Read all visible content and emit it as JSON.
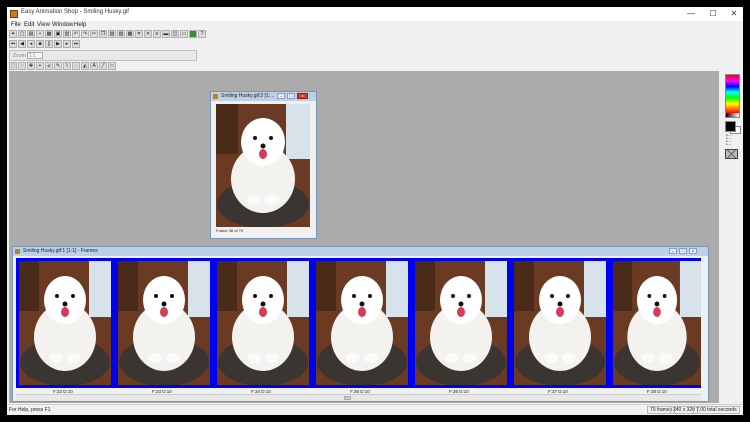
{
  "window": {
    "title": "Easy Animation Shop - Smiling Husky.gif",
    "controls": {
      "minimize": "—",
      "maximize": "☐",
      "close": "✕"
    }
  },
  "menu": [
    "File",
    "Edit",
    "View",
    "Window",
    "Help"
  ],
  "zoom": {
    "label": "Zoom",
    "value": "1:1"
  },
  "preview_window": {
    "title": "Smiling Husky.gif:2 [1:...",
    "caption": "Frame 38 of 70"
  },
  "frames_window": {
    "title": "Smiling Husky.gif:1 [1:1] - Frames",
    "frames": [
      {
        "label": "F:32  D:10"
      },
      {
        "label": "F:33  D:10"
      },
      {
        "label": "F:34  D:10"
      },
      {
        "label": "F:35  D:10"
      },
      {
        "label": "F:36  D:10"
      },
      {
        "label": "F:37  D:10"
      },
      {
        "label": "F:38  D:10"
      }
    ]
  },
  "status": {
    "help": "For Help, press F1",
    "frames": "70 frames",
    "size": "240 x 320",
    "duration": "7.00 total seconds"
  },
  "colors": {
    "frame_strip_bg": "#0000f0",
    "workspace_bg": "#ababab"
  }
}
